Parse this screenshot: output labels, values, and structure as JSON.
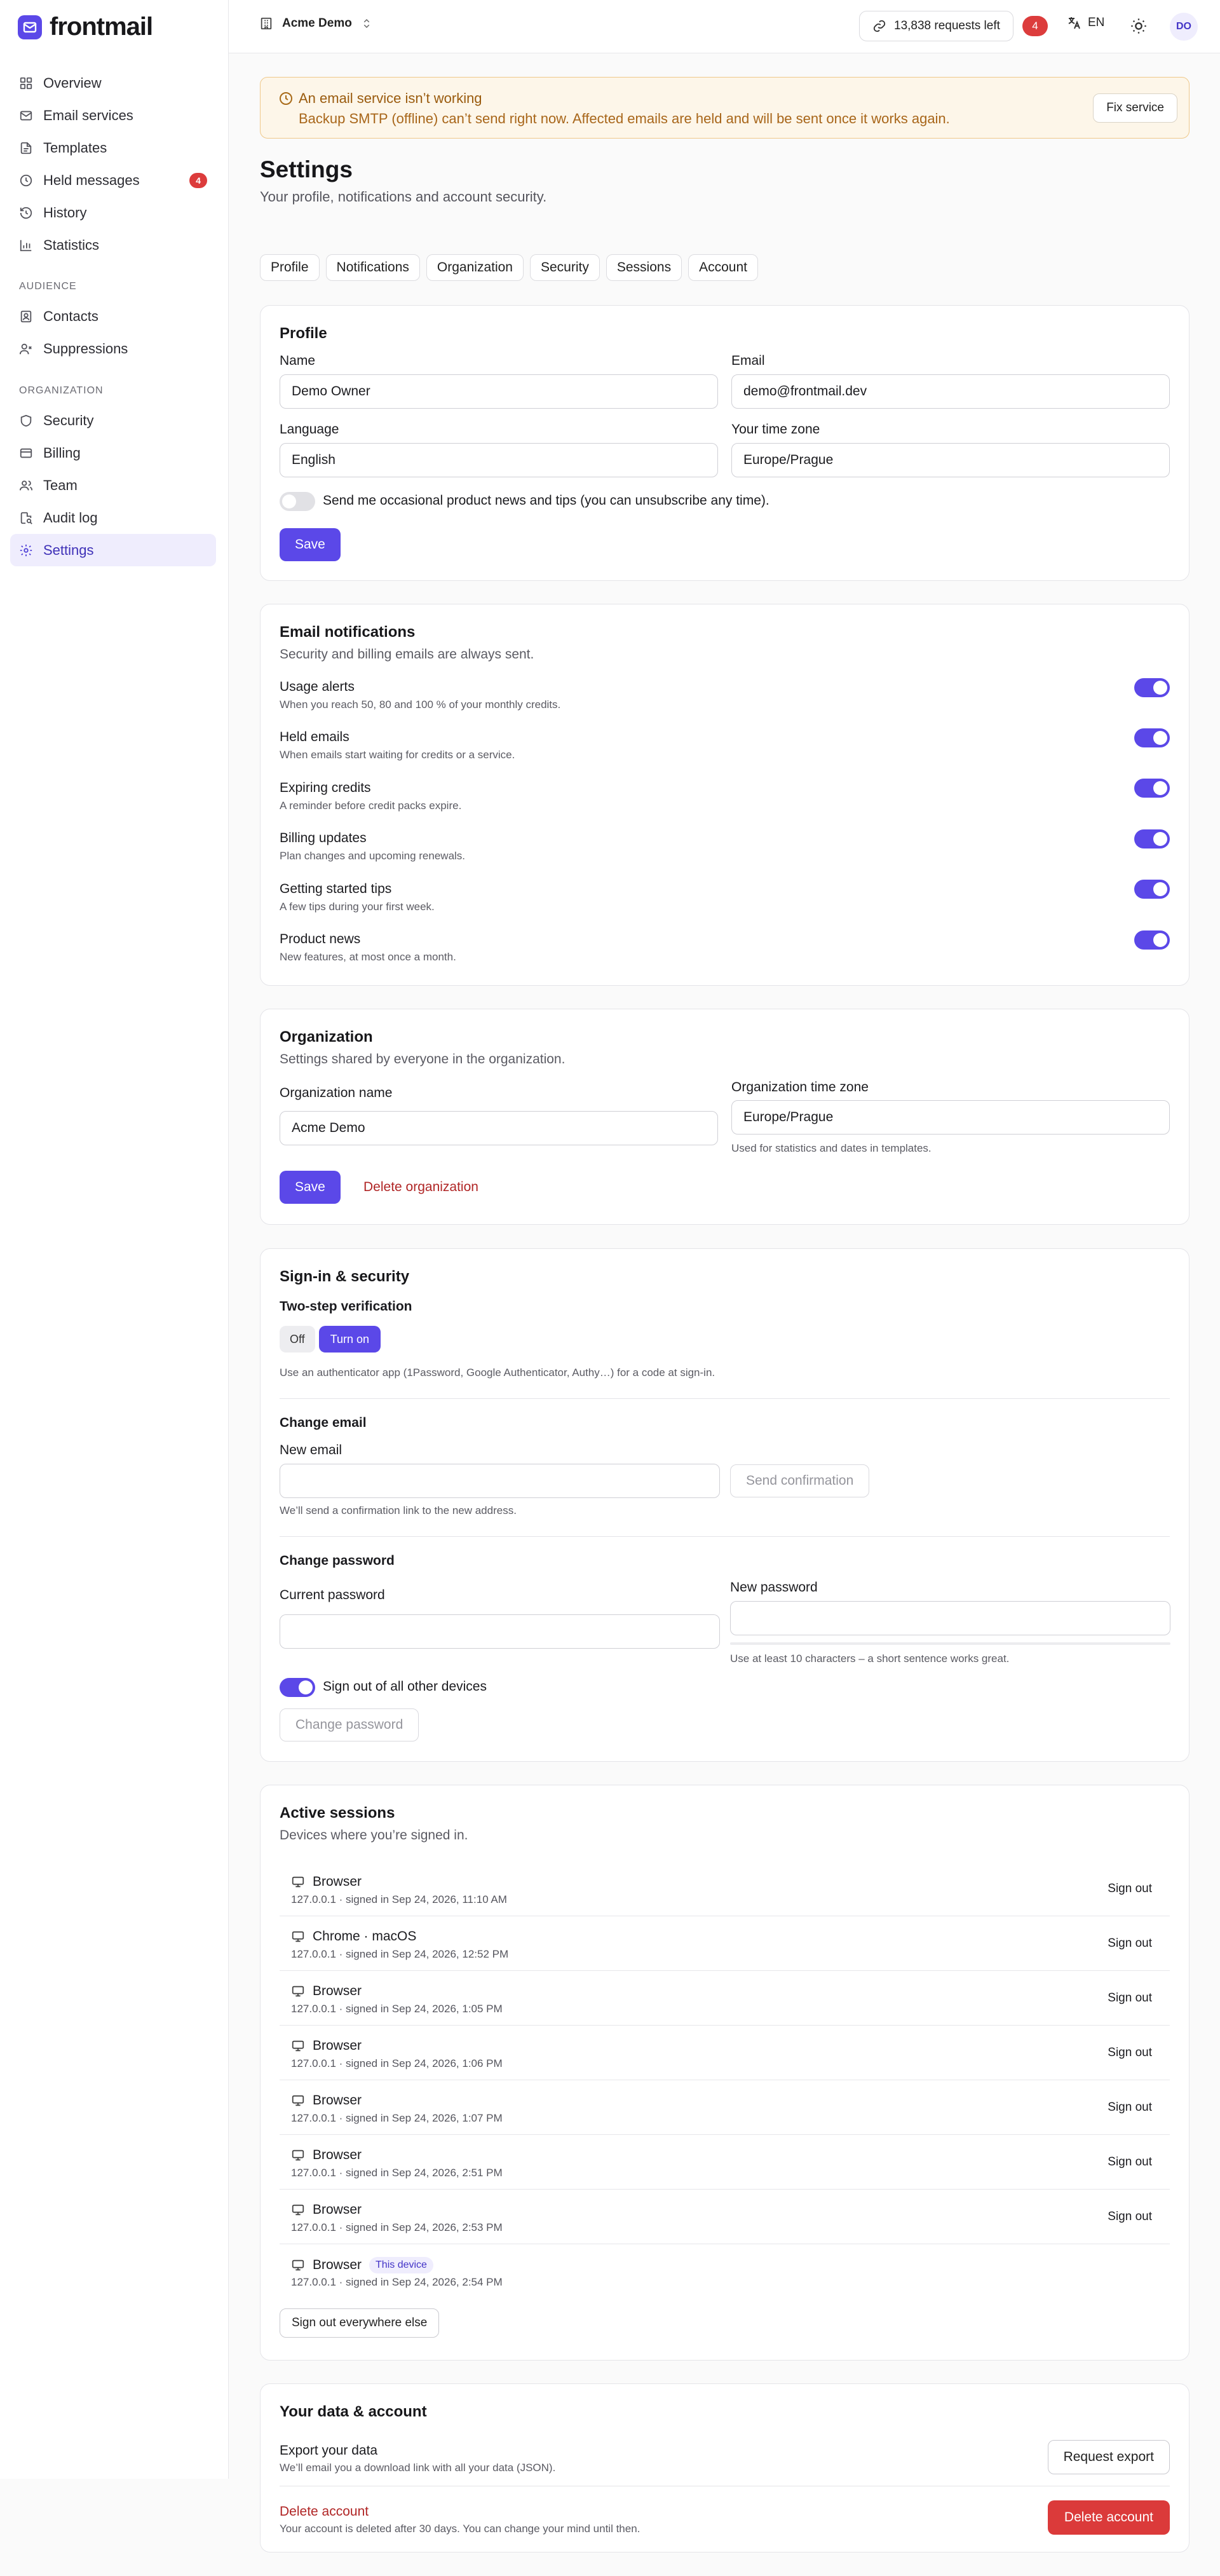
{
  "brand": {
    "name": "frontmail"
  },
  "sidebar": {
    "items": [
      {
        "label": "Overview",
        "icon": "grid-icon"
      },
      {
        "label": "Email services",
        "icon": "mail-icon"
      },
      {
        "label": "Templates",
        "icon": "template-icon"
      },
      {
        "label": "Held messages",
        "icon": "clock-icon",
        "badge": "4"
      },
      {
        "label": "History",
        "icon": "history-icon"
      },
      {
        "label": "Statistics",
        "icon": "chart-icon"
      }
    ],
    "audience_heading": "AUDIENCE",
    "audience_items": [
      {
        "label": "Contacts",
        "icon": "contacts-icon"
      },
      {
        "label": "Suppressions",
        "icon": "user-x-icon"
      }
    ],
    "org_heading": "ORGANIZATION",
    "org_items": [
      {
        "label": "Security",
        "icon": "shield-icon"
      },
      {
        "label": "Billing",
        "icon": "card-icon"
      },
      {
        "label": "Team",
        "icon": "team-icon"
      },
      {
        "label": "Audit log",
        "icon": "audit-icon"
      },
      {
        "label": "Settings",
        "icon": "gear-icon",
        "active": true
      }
    ]
  },
  "topbar": {
    "workspace": "Acme Demo",
    "requests_left": "13,838 requests left",
    "alerts_count": "4",
    "language": "EN",
    "avatar_initials": "DO"
  },
  "alert": {
    "title": "An email service isn’t working",
    "body": "Backup SMTP (offline) can’t send right now. Affected emails are held and will be sent once it works again.",
    "action": "Fix service"
  },
  "page": {
    "title": "Settings",
    "subtitle": "Your profile, notifications and account security.",
    "tabs": [
      "Profile",
      "Notifications",
      "Organization",
      "Security",
      "Sessions",
      "Account"
    ]
  },
  "profile": {
    "title": "Profile",
    "name_label": "Name",
    "name_value": "Demo Owner",
    "email_label": "Email",
    "email_value": "demo@frontmail.dev",
    "language_label": "Language",
    "language_value": "English",
    "timezone_label": "Your time zone",
    "timezone_value": "Europe/Prague",
    "newsletter_label": "Send me occasional product news and tips (you can unsubscribe any time).",
    "newsletter_on": false,
    "save": "Save"
  },
  "notifications": {
    "title": "Email notifications",
    "subtitle": "Security and billing emails are always sent.",
    "items": [
      {
        "title": "Usage alerts",
        "desc": "When you reach 50, 80 and 100 % of your monthly credits.",
        "on": true
      },
      {
        "title": "Held emails",
        "desc": "When emails start waiting for credits or a service.",
        "on": true
      },
      {
        "title": "Expiring credits",
        "desc": "A reminder before credit packs expire.",
        "on": true
      },
      {
        "title": "Billing updates",
        "desc": "Plan changes and upcoming renewals.",
        "on": true
      },
      {
        "title": "Getting started tips",
        "desc": "A few tips during your first week.",
        "on": true
      },
      {
        "title": "Product news",
        "desc": "New features, at most once a month.",
        "on": true
      }
    ]
  },
  "organization": {
    "title": "Organization",
    "subtitle": "Settings shared by everyone in the organization.",
    "name_label": "Organization name",
    "name_value": "Acme Demo",
    "timezone_label": "Organization time zone",
    "timezone_value": "Europe/Prague",
    "timezone_help": "Used for statistics and dates in templates.",
    "save": "Save",
    "delete": "Delete organization"
  },
  "security": {
    "title": "Sign-in & security",
    "twostep_heading": "Two-step verification",
    "twostep_off": "Off",
    "twostep_on": "Turn on",
    "twostep_help": "Use an authenticator app (1Password, Google Authenticator, Authy…) for a code at sign-in.",
    "change_email_heading": "Change email",
    "new_email_label": "New email",
    "new_email_value": "",
    "send_confirmation": "Send confirmation",
    "email_help": "We’ll send a confirmation link to the new address.",
    "change_password_heading": "Change password",
    "current_password_label": "Current password",
    "new_password_label": "New password",
    "password_help": "Use at least 10 characters – a short sentence works great.",
    "signout_others_label": "Sign out of all other devices",
    "signout_others_on": true,
    "change_password_button": "Change password"
  },
  "sessions": {
    "title": "Active sessions",
    "subtitle": "Devices where you’re signed in.",
    "signout_label": "Sign out",
    "this_device_label": "This device",
    "items": [
      {
        "device": "Browser",
        "meta": "127.0.0.1 · signed in Sep 24, 2026, 11:10 AM"
      },
      {
        "device": "Chrome · macOS",
        "meta": "127.0.0.1 · signed in Sep 24, 2026, 12:52 PM"
      },
      {
        "device": "Browser",
        "meta": "127.0.0.1 · signed in Sep 24, 2026, 1:05 PM"
      },
      {
        "device": "Browser",
        "meta": "127.0.0.1 · signed in Sep 24, 2026, 1:06 PM"
      },
      {
        "device": "Browser",
        "meta": "127.0.0.1 · signed in Sep 24, 2026, 1:07 PM"
      },
      {
        "device": "Browser",
        "meta": "127.0.0.1 · signed in Sep 24, 2026, 2:51 PM"
      },
      {
        "device": "Browser",
        "meta": "127.0.0.1 · signed in Sep 24, 2026, 2:53 PM"
      },
      {
        "device": "Browser",
        "meta": "127.0.0.1 · signed in Sep 24, 2026, 2:54 PM",
        "current": true
      }
    ],
    "signout_everywhere": "Sign out everywhere else"
  },
  "account": {
    "title": "Your data & account",
    "export_title": "Export your data",
    "export_desc": "We’ll email you a download link with all your data (JSON).",
    "export_button": "Request export",
    "delete_title": "Delete account",
    "delete_desc": "Your account is deleted after 30 days. You can change your mind until then.",
    "delete_button": "Delete account"
  },
  "colors": {
    "accent": "#5b48e8",
    "danger": "#db3a3a",
    "warning_bg": "#fdf6e9"
  }
}
